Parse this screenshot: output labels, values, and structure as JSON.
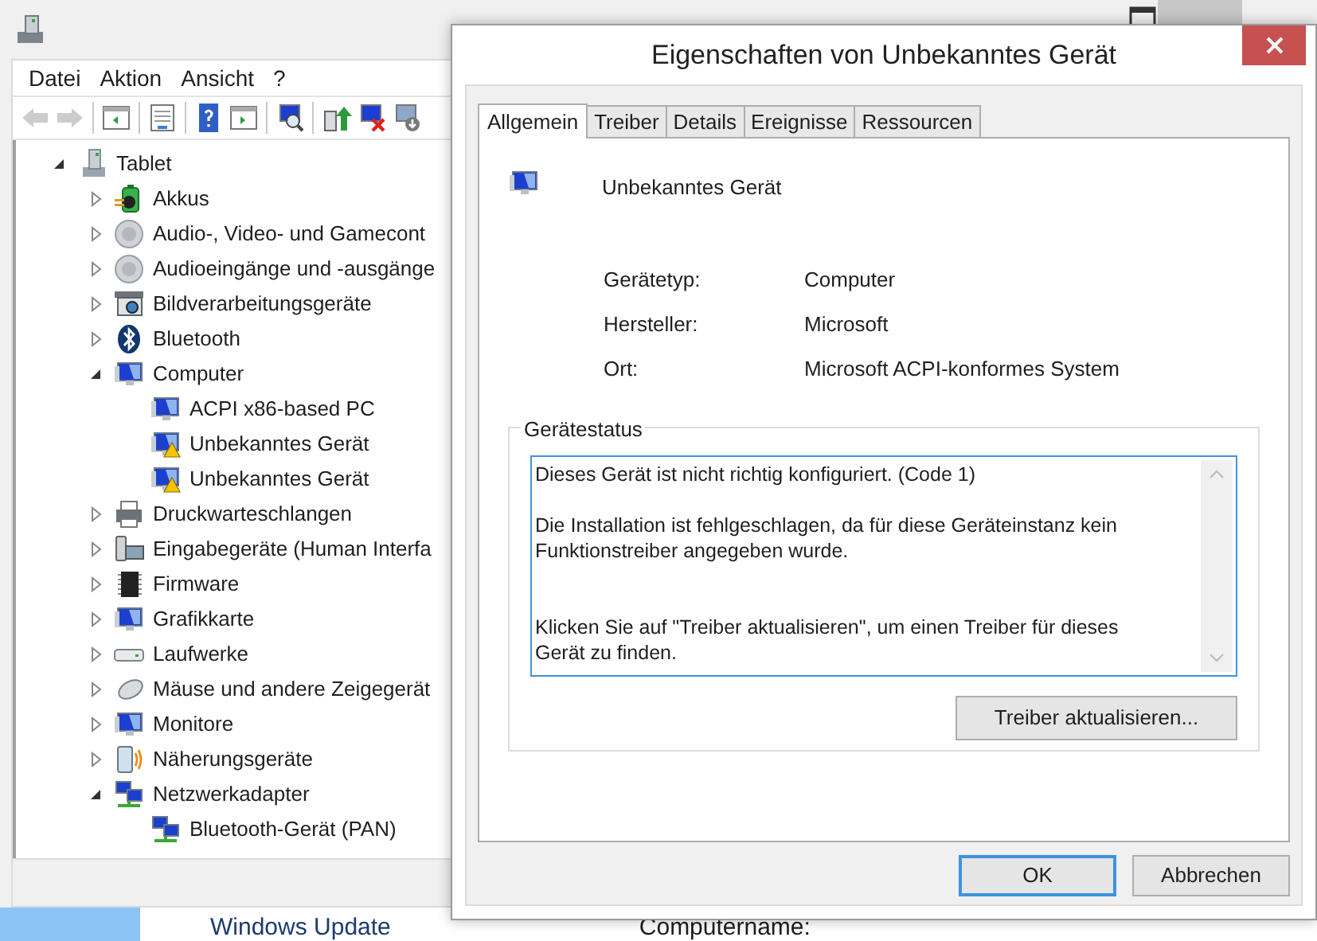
{
  "main_window": {
    "menu": [
      "Datei",
      "Aktion",
      "Ansicht",
      "?"
    ],
    "toolbar": [
      {
        "kind": "back",
        "disabled": true
      },
      {
        "kind": "forward",
        "disabled": true
      },
      {
        "kind": "sep"
      },
      {
        "kind": "tree",
        "disabled": false
      },
      {
        "kind": "sep"
      },
      {
        "kind": "props",
        "disabled": false
      },
      {
        "kind": "sep"
      },
      {
        "kind": "help",
        "disabled": false
      },
      {
        "kind": "pane",
        "disabled": false
      },
      {
        "kind": "sep"
      },
      {
        "kind": "scan",
        "disabled": false
      },
      {
        "kind": "sep"
      },
      {
        "kind": "update",
        "disabled": false
      },
      {
        "kind": "uninstall",
        "disabled": false
      },
      {
        "kind": "disable",
        "disabled": false
      }
    ],
    "tree": [
      {
        "label": "Tablet",
        "kind": "tower",
        "expanded": true,
        "children": [
          {
            "label": "Akkus",
            "kind": "battery",
            "expanded": false
          },
          {
            "label": "Audio-, Video- und Gamecont",
            "kind": "speaker",
            "expanded": false
          },
          {
            "label": "Audioeingänge und -ausgänge",
            "kind": "speaker",
            "expanded": false
          },
          {
            "label": "Bildverarbeitungsgeräte",
            "kind": "camera",
            "expanded": false
          },
          {
            "label": "Bluetooth",
            "kind": "bluetooth",
            "expanded": false
          },
          {
            "label": "Computer",
            "kind": "monitor",
            "expanded": true,
            "children": [
              {
                "label": "ACPI x86-based PC",
                "kind": "monitor",
                "warning": false
              },
              {
                "label": "Unbekanntes Gerät",
                "kind": "monitor",
                "warning": true
              },
              {
                "label": "Unbekanntes Gerät",
                "kind": "monitor",
                "warning": true
              }
            ]
          },
          {
            "label": "Druckwarteschlangen",
            "kind": "printer",
            "expanded": false
          },
          {
            "label": "Eingabegeräte (Human Interfa",
            "kind": "keyboard",
            "expanded": false
          },
          {
            "label": "Firmware",
            "kind": "chip",
            "expanded": false
          },
          {
            "label": "Grafikkarte",
            "kind": "monitor",
            "expanded": false
          },
          {
            "label": "Laufwerke",
            "kind": "drive",
            "expanded": false
          },
          {
            "label": "Mäuse und andere Zeigegerät",
            "kind": "mouse",
            "expanded": false
          },
          {
            "label": "Monitore",
            "kind": "monitor",
            "expanded": false
          },
          {
            "label": "Näherungsgeräte",
            "kind": "phone",
            "expanded": false
          },
          {
            "label": "Netzwerkadapter",
            "kind": "network",
            "expanded": true,
            "children": [
              {
                "label": "Bluetooth-Gerät (PAN)",
                "kind": "network",
                "warning": false
              }
            ]
          }
        ]
      }
    ]
  },
  "behind": [
    "Windows Update",
    "Computername:"
  ],
  "dialog": {
    "title": "Eigenschaften von Unbekanntes Gerät",
    "tabs": [
      {
        "label": "Allgemein",
        "selected": true
      },
      {
        "label": "Treiber",
        "selected": false
      },
      {
        "label": "Details",
        "selected": false
      },
      {
        "label": "Ereignisse",
        "selected": false
      },
      {
        "label": "Ressourcen",
        "selected": false
      }
    ],
    "device_name": "Unbekanntes Gerät",
    "properties": [
      {
        "label": "Gerätetyp:",
        "value": "Computer"
      },
      {
        "label": "Hersteller:",
        "value": "Microsoft"
      },
      {
        "label": "Ort:",
        "value": "Microsoft ACPI-konformes System"
      }
    ],
    "status_group": "Gerätestatus",
    "status_text": "Dieses Gerät ist nicht richtig konfiguriert. (Code 1)\n\nDie Installation ist fehlgeschlagen, da für diese Geräteinstanz kein\nFunktionstreiber angegeben wurde.\n\n\nKlicken Sie auf \"Treiber aktualisieren\", um einen Treiber für dieses\nGerät zu finden.",
    "update_button": "Treiber aktualisieren...",
    "buttons": [
      {
        "label": "OK",
        "default": true
      },
      {
        "label": "Abbrechen",
        "default": false
      }
    ]
  }
}
